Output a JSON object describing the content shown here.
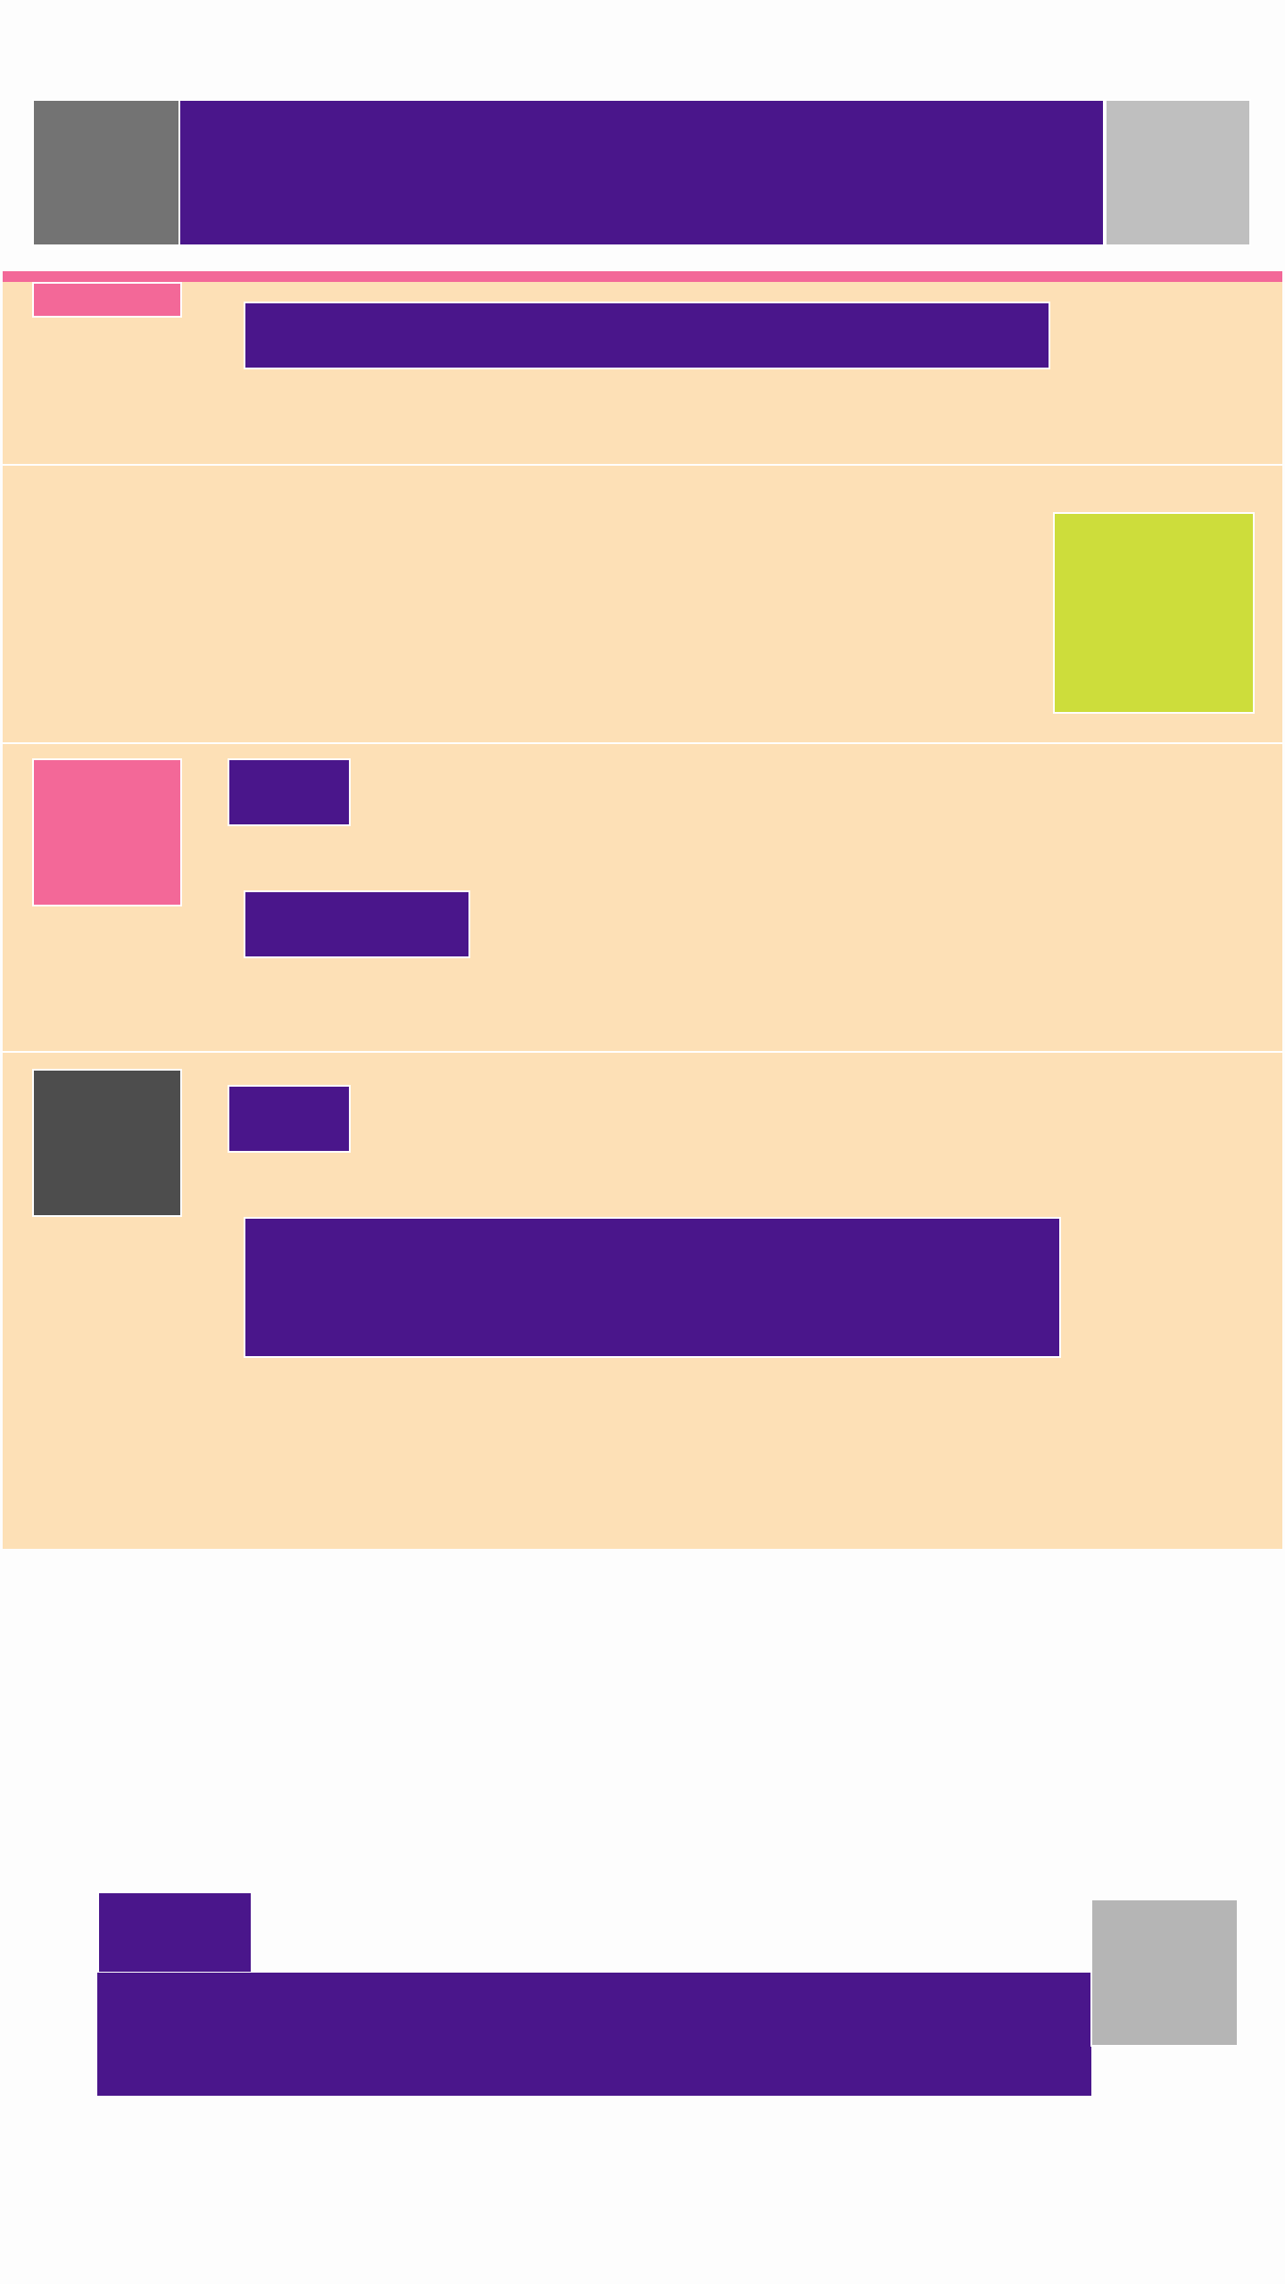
{
  "colors": {
    "page_bg": "#fdfdfd",
    "accent": "#4a168b",
    "peach": "#fde0b6",
    "pink": "#f36898",
    "lime": "#cddd3b",
    "gray": "#737373",
    "light_gray": "#bfbfbf",
    "dark_gray": "#4d4d4d",
    "mid_gray": "#b5b5b5"
  },
  "header": {
    "logo_icon": "app-logo-icon",
    "title": "",
    "menu_icon": "menu-icon"
  },
  "feed": {
    "items": [
      {
        "id": "item-1",
        "avatar_icon": "avatar-icon",
        "author": "",
        "text": ""
      },
      {
        "id": "item-2",
        "thumbnail_icon": "image-thumbnail-icon"
      },
      {
        "id": "item-3",
        "avatar_icon": "avatar-icon",
        "author": "",
        "text": ""
      },
      {
        "id": "item-4",
        "avatar_icon": "avatar-icon",
        "author": "",
        "text": ""
      }
    ]
  },
  "footer": {
    "label": "",
    "text": "",
    "image_icon": "image-icon"
  }
}
